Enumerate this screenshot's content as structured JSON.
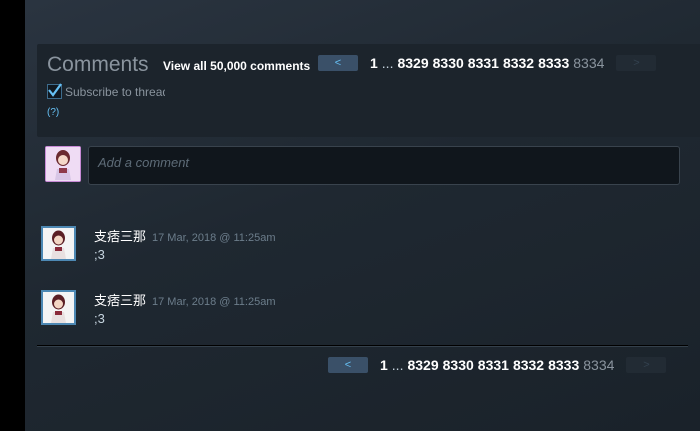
{
  "comments_section": {
    "title": "Comments",
    "view_all": "View all 50,000 comments",
    "subscribe_label": "Subscribe to thread",
    "help_link": "(?)",
    "input_placeholder": "Add a comment"
  },
  "pagination": {
    "prev_icon": "<",
    "next_icon": ">",
    "first_page": "1",
    "ellipsis": "...",
    "pages": [
      "8329",
      "8330",
      "8331",
      "8332",
      "8333"
    ],
    "current_page": "8334"
  },
  "comments": [
    {
      "author": "支痞三那",
      "timestamp": "17 Mar, 2018 @ 11:25am",
      "text": ";3"
    },
    {
      "author": "支痞三那",
      "timestamp": "17 Mar, 2018 @ 11:25am",
      "text": ";3"
    }
  ],
  "colors": {
    "accent": "#66c0f4",
    "background": "#1b2229",
    "panel": "#1c242c",
    "avatar_border": "#4d88b3"
  },
  "icons": {
    "checkbox": "checkmark-icon",
    "prev": "chevron-left-icon",
    "next": "chevron-right-icon"
  }
}
